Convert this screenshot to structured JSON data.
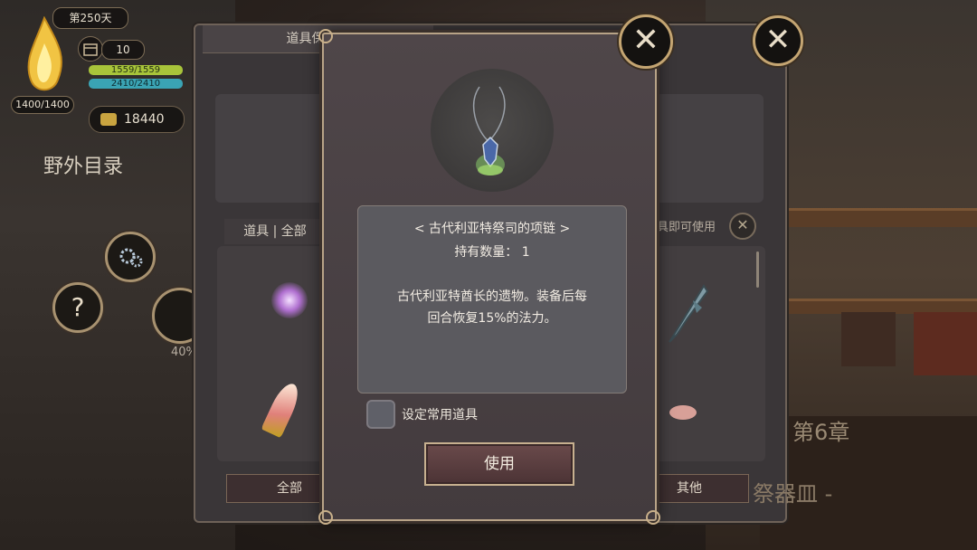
{
  "hud": {
    "day": "第250天",
    "calendar_value": "10",
    "flame_value": "1400/1400",
    "hp": "1559/1559",
    "mp": "2410/2410",
    "gold": "18440",
    "wild_catalog": "野外目录",
    "percent": "40%"
  },
  "back_panel": {
    "title": "道具保管箱",
    "tab": "道具 | 全部",
    "hint": "具即可使用",
    "bottom_tabs": [
      "全部",
      "其他"
    ]
  },
  "modal": {
    "item_name": "< 古代利亚特祭司的项链 >",
    "qty": "持有数量：  1",
    "desc_line1": "古代利亚特酋长的遗物。装备后每",
    "desc_line2": "回合恢复15%的法力。",
    "checkbox_label": "设定常用道具",
    "use_button": "使用"
  },
  "scene": {
    "chapter": "第6章",
    "subtitle": "祭器皿 -"
  },
  "colors": {
    "hp_bar": "#a8c43a",
    "mp_bar": "#3aa4b4",
    "gold_frame": "#c4a572"
  },
  "icons": {
    "close": "close-icon",
    "gear": "gear-icon",
    "help": "question-icon",
    "calendar": "calendar-icon",
    "gold": "gold-coins-icon",
    "necklace": "necklace-icon"
  }
}
